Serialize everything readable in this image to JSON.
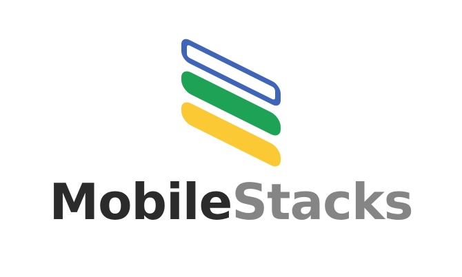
{
  "logo": {
    "word_primary": "Mobile",
    "word_secondary": "Stacks",
    "colors": {
      "primary_text": "#2b2b2b",
      "secondary_text": "#858585",
      "layer_top": "#3f65b8",
      "layer_middle": "#1ea356",
      "layer_bottom": "#fbc934",
      "background": "#ffffff"
    },
    "icon": "stacked-layers-icon"
  }
}
